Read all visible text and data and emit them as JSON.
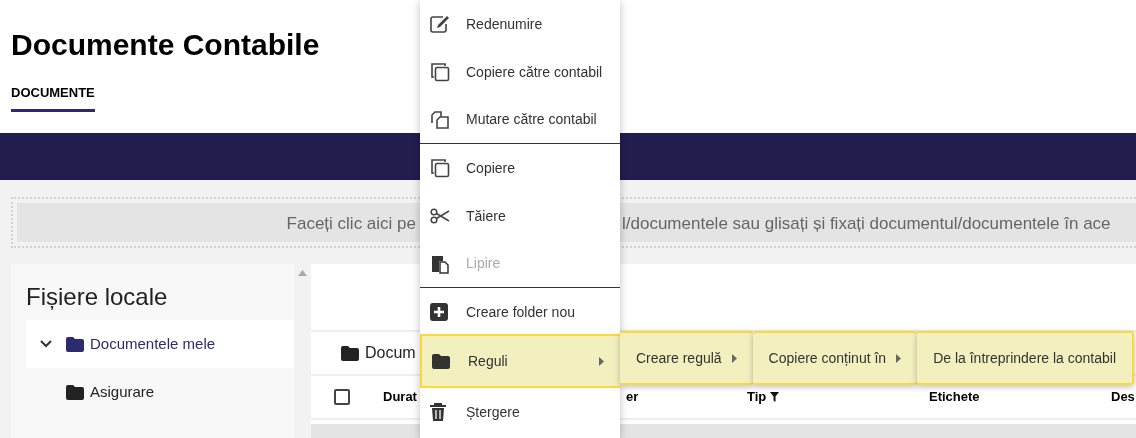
{
  "page_title": "Documente Contabile",
  "tabs": [
    {
      "label": "DOCUMENTE",
      "selected": true
    }
  ],
  "drop_zone": {
    "text_left": "Faceți clic aici pe",
    "text_right": "l/documentele sau glisați și fixați documentul/documentele în ace"
  },
  "local_files": {
    "title": "Fișiere locale",
    "tree": [
      {
        "label": "Documentele mele",
        "expanded": true,
        "selected": true,
        "children": [
          {
            "label": "Asigurare",
            "selected": false
          }
        ]
      }
    ]
  },
  "breadcrumb": "Docum",
  "table": {
    "select_all_checked": false,
    "columns": [
      {
        "label": "Durat"
      },
      {
        "label": "er"
      },
      {
        "label": "Tip",
        "filter": true
      },
      {
        "label": "Etichete"
      },
      {
        "label": "Des"
      }
    ]
  },
  "context_menu": {
    "items": [
      {
        "label": "Redenumire",
        "disabled": false,
        "selected": false,
        "submenu": false,
        "divider_after": false
      },
      {
        "label": "Copiere către contabil",
        "disabled": false,
        "selected": false,
        "submenu": false,
        "divider_after": false
      },
      {
        "label": "Mutare către contabil",
        "disabled": false,
        "selected": false,
        "submenu": false,
        "divider_after": true
      },
      {
        "label": "Copiere",
        "disabled": false,
        "selected": false,
        "submenu": false,
        "divider_after": false
      },
      {
        "label": "Tăiere",
        "disabled": false,
        "selected": false,
        "submenu": false,
        "divider_after": false
      },
      {
        "label": "Lipire",
        "disabled": true,
        "selected": false,
        "submenu": false,
        "divider_after": true
      },
      {
        "label": "Creare folder nou",
        "disabled": false,
        "selected": false,
        "submenu": false,
        "divider_after": false
      },
      {
        "label": "Reguli",
        "disabled": false,
        "selected": true,
        "submenu": true,
        "divider_after": false
      },
      {
        "label": "Ștergere",
        "disabled": false,
        "selected": false,
        "submenu": false,
        "divider_after": false
      }
    ],
    "submenus": [
      {
        "label": "Creare regulă",
        "submenu": true
      },
      {
        "label": "Copiere conținut în",
        "submenu": true
      },
      {
        "label": "De la întreprindere la contabil",
        "submenu": false
      }
    ]
  }
}
